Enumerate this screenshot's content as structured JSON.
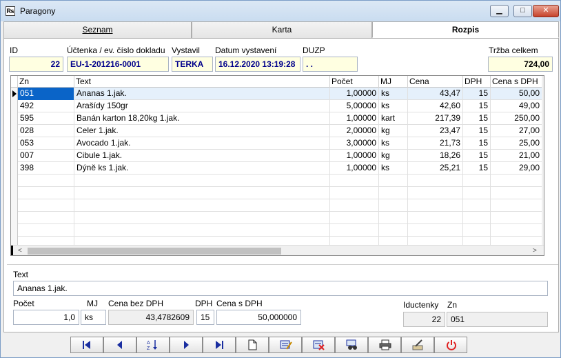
{
  "window": {
    "title": "Paragony",
    "icon": "receipt-icon"
  },
  "tabs": [
    {
      "label": "Seznam"
    },
    {
      "label": "Karta"
    },
    {
      "label": "Rozpis"
    }
  ],
  "header": {
    "id_label": "ID",
    "id_value": "22",
    "doc_label": "Účtenka / ev. číslo dokladu",
    "doc_value": "EU-1-201216-0001",
    "issuer_label": "Vystavil",
    "issuer_value": "TERKA",
    "date_label": "Datum vystavení",
    "date_value": "16.12.2020 13:19:28",
    "duzp_label": "DUZP",
    "duzp_value": ". .",
    "total_label": "Tržba celkem",
    "total_value": "724,00"
  },
  "grid": {
    "columns": [
      "Zn",
      "Text",
      "Počet",
      "MJ",
      "Cena",
      "DPH",
      "Cena s DPH"
    ],
    "rows": [
      [
        "051",
        "Ananas 1.jak.",
        "1,00000",
        "ks",
        "43,47",
        "15",
        "50,00"
      ],
      [
        "492",
        "Arašídy 150gr",
        "5,00000",
        "ks",
        "42,60",
        "15",
        "49,00"
      ],
      [
        "595",
        "Banán karton  18,20kg 1.jak.",
        "1,00000",
        "kart",
        "217,39",
        "15",
        "250,00"
      ],
      [
        "028",
        "Celer 1.jak.",
        "2,00000",
        "kg",
        "23,47",
        "15",
        "27,00"
      ],
      [
        "053",
        "Avocado 1.jak.",
        "3,00000",
        "ks",
        "21,73",
        "15",
        "25,00"
      ],
      [
        "007",
        "Cibule 1.jak.",
        "1,00000",
        "kg",
        "18,26",
        "15",
        "21,00"
      ],
      [
        "398",
        "Dýně ks 1.jak.",
        "1,00000",
        "ks",
        "25,21",
        "15",
        "29,00"
      ]
    ],
    "selected_row": 0
  },
  "detail": {
    "text_label": "Text",
    "text_value": "Ananas 1.jak.",
    "qty_label": "Počet",
    "qty_value": "1,0",
    "unit_label": "MJ",
    "unit_value": "ks",
    "price_label": "Cena bez DPH",
    "price_value": "43,4782609",
    "vat_label": "DPH",
    "vat_value": "15",
    "price_vat_label": "Cena s DPH",
    "price_vat_value": "50,000000",
    "receipt_id_label": "Iductenky",
    "receipt_id_value": "22",
    "zn_label": "Zn",
    "zn_value": "051"
  },
  "toolbar": {
    "buttons": [
      "first-record",
      "previous-record",
      "sort",
      "next-record",
      "last-record",
      "new-record",
      "edit-record",
      "delete-record",
      "search-record",
      "print",
      "settings",
      "exit"
    ]
  },
  "colors": {
    "selection": "#e5f0fb",
    "field_bg": "#ffffe1",
    "field_text": "#00008b",
    "exit_red": "#e02020"
  }
}
